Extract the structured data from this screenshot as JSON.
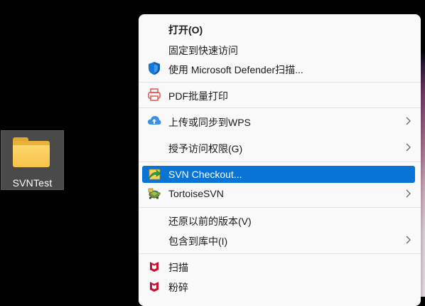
{
  "desktop": {
    "folder_label": "SVNTest"
  },
  "menu": {
    "items": [
      {
        "label": "打开(O)"
      },
      {
        "label": "固定到快速访问"
      },
      {
        "label": "使用 Microsoft Defender扫描..."
      },
      {
        "label": "PDF批量打印"
      },
      {
        "label": "上传或同步到WPS"
      },
      {
        "label": "授予访问权限(G)"
      },
      {
        "label": "SVN Checkout..."
      },
      {
        "label": "TortoiseSVN"
      },
      {
        "label": "还原以前的版本(V)"
      },
      {
        "label": "包含到库中(I)"
      },
      {
        "label": "扫描"
      },
      {
        "label": "粉碎"
      }
    ],
    "selected_item": "SVN Checkout...",
    "icons": {
      "defender": "shield-icon",
      "pdf": "printer-icon",
      "wps": "cloud-upload-icon",
      "svn_checkout": "svn-checkout-icon",
      "tortoise": "tortoisesvn-icon",
      "mcafee": "mcafee-icon"
    },
    "colors": {
      "menu_background": "#f9f9f9",
      "highlight": "#0a74d6",
      "defender_blue": "#1677d6",
      "mcafee_red": "#c8102e"
    }
  }
}
